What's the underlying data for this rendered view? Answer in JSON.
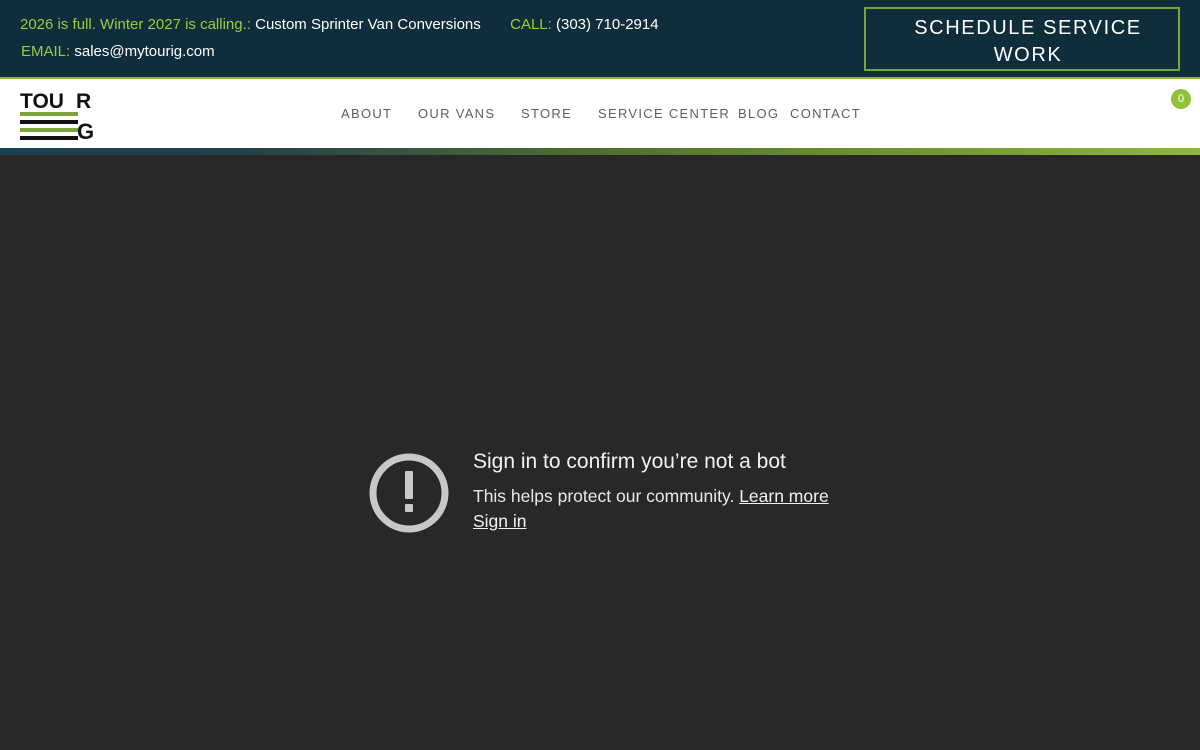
{
  "topbar": {
    "promo_label": "2026 is full. Winter 2027 is calling.:",
    "promo_link": "Custom Sprinter Van Conversions",
    "call_label": "CALL:",
    "call_number": "(303) 710-2914",
    "email_label": "EMAIL:",
    "email_value": "sales@mytourig.com",
    "cta_line1": "SCHEDULE SERVICE",
    "cta_line2": "WORK"
  },
  "logo": {
    "text_top": "TOU",
    "text_r": "R",
    "text_g": "G",
    "accent_color": "#7aa33a"
  },
  "nav": {
    "items": [
      {
        "label": "ABOUT"
      },
      {
        "label": "OUR VANS"
      },
      {
        "label": "STORE"
      },
      {
        "label": "SERVICE CENTER"
      },
      {
        "label": "BLOG"
      },
      {
        "label": "CONTACT"
      }
    ],
    "cart_count": "0"
  },
  "message": {
    "title": "Sign in to confirm you’re not a bot",
    "subtitle": "This helps protect our community.",
    "learn_more": "Learn more",
    "sign_in": "Sign in"
  },
  "colors": {
    "topbar_bg": "#0f2d3a",
    "accent_green": "#9ccc3c",
    "main_bg": "#282828"
  }
}
